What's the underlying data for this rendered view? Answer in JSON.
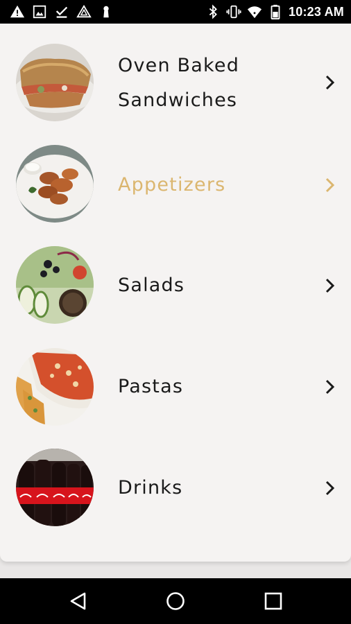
{
  "status_bar": {
    "time": "10:23 AM",
    "left_icons": [
      "warning-icon",
      "image-icon",
      "download-done-icon",
      "drive-icon",
      "keyhole-icon"
    ],
    "right_icons": [
      "bluetooth-icon",
      "vibrate-icon",
      "wifi-icon",
      "battery-icon"
    ]
  },
  "menu": {
    "items": [
      {
        "label_line1": "Oven Baked",
        "label_line2": "Sandwiches",
        "image": "sandwich-image",
        "highlighted": false
      },
      {
        "label": "Appetizers",
        "image": "wings-image",
        "highlighted": true
      },
      {
        "label": "Salads",
        "image": "salad-image",
        "highlighted": false
      },
      {
        "label": "Pastas",
        "image": "pasta-image",
        "highlighted": false
      },
      {
        "label": "Drinks",
        "image": "soda-bottles-image",
        "highlighted": false
      }
    ]
  },
  "colors": {
    "highlight": "#dbb66f",
    "text": "#1a1a1a",
    "card_bg": "#f5f3f2",
    "page_bg": "#e9e7e6"
  },
  "nav_bar": {
    "buttons": [
      "back-icon",
      "home-icon",
      "recents-icon"
    ]
  }
}
